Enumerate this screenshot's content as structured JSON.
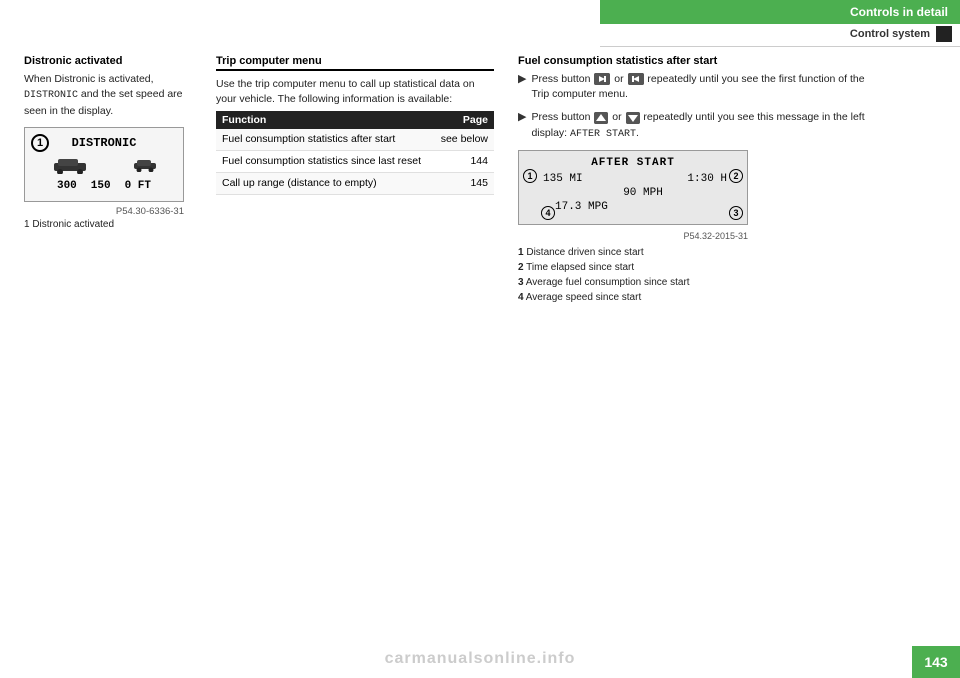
{
  "header": {
    "title": "Controls in detail",
    "subtitle": "Control system"
  },
  "page_number": "143",
  "watermark": "carmanualsonline.info",
  "left_col": {
    "section_heading": "Distronic activated",
    "body_text": "When Distronic is activated, DISTRONIC and the set speed are seen in the display.",
    "distronic_label": "DISTRONIC",
    "distronic_numbers": "300   150   0 FT",
    "image_caption": "P54.30-6336-31",
    "caption_label": "1 Distronic activated"
  },
  "middle_col": {
    "section_heading": "Trip computer menu",
    "intro_text": "Use the trip computer menu to call up statistical data on your vehicle. The following information is available:",
    "table": {
      "col1": "Function",
      "col2": "Page",
      "rows": [
        {
          "function": "Fuel consumption statistics after start",
          "page": "see below"
        },
        {
          "function": "Fuel consumption statistics since last reset",
          "page": "144"
        },
        {
          "function": "Call up range (distance to empty)",
          "page": "145"
        }
      ]
    }
  },
  "right_col": {
    "section_heading": "Fuel consumption statistics after start",
    "bullet1_text1": "Press button",
    "bullet1_text2": "or",
    "bullet1_text3": "repeatedly until you see the first function of the Trip computer menu.",
    "bullet2_text1": "Press button",
    "bullet2_text2": "or",
    "bullet2_text3": "repeatedly until you see this message in the left display: AFTER START.",
    "after_start_title": "AFTER START",
    "after_start_line1_left": "135 MI",
    "after_start_line1_right": "1:30 H",
    "after_start_line2": "90 MPH",
    "after_start_line3": "17.3 MPG",
    "image_caption": "P54.32-2015-31",
    "numbered_items": [
      {
        "num": "1",
        "text": "Distance driven since start"
      },
      {
        "num": "2",
        "text": "Time elapsed since start"
      },
      {
        "num": "3",
        "text": "Average fuel consumption since start"
      },
      {
        "num": "4",
        "text": "Average speed since start"
      }
    ]
  }
}
